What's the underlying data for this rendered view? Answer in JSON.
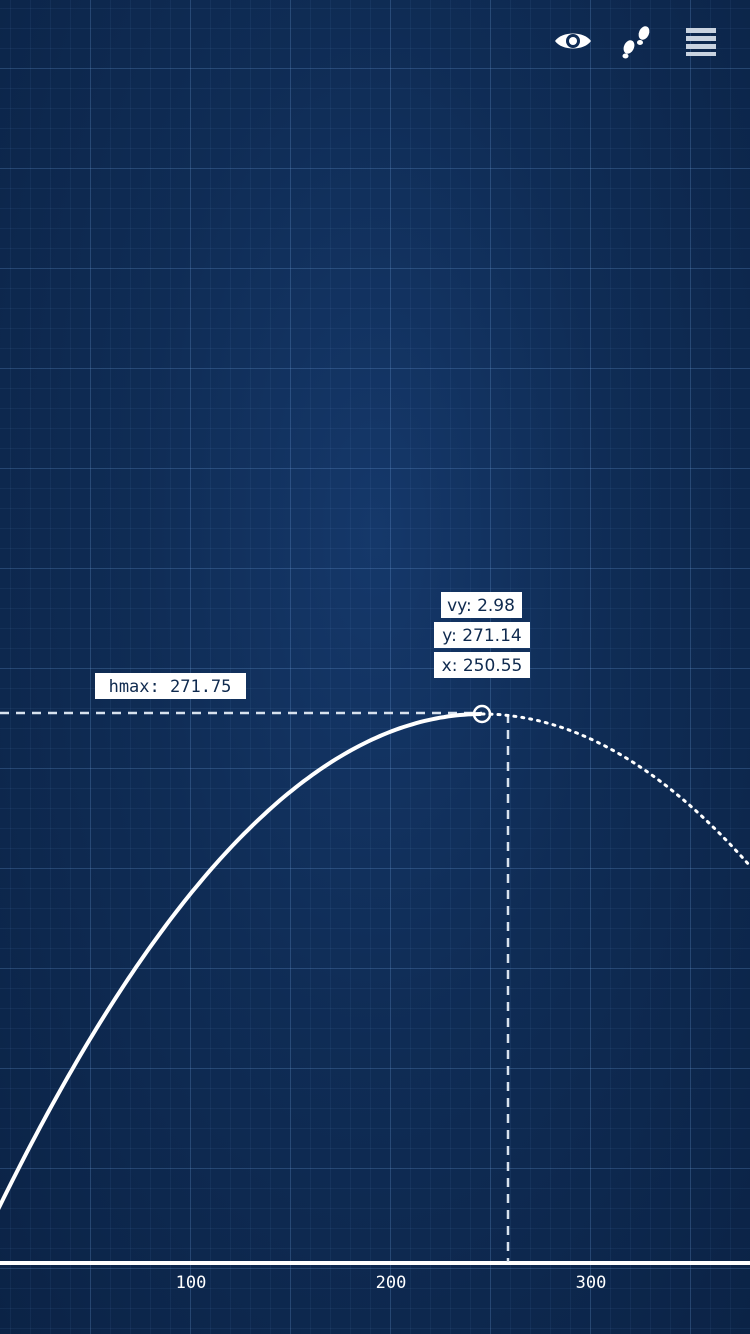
{
  "toolbar": {
    "icons": [
      "eye-icon",
      "footprints-icon",
      "menu-icon"
    ]
  },
  "hmax_label": "hmax: 271.75",
  "readout": {
    "vy": "vy: 2.98",
    "y": "y: 271.14",
    "x": "x: 250.55"
  },
  "chart_data": {
    "type": "line",
    "x_ticks": [
      "100",
      "200",
      "300"
    ],
    "hmax": 271.75,
    "current_point": {
      "x": 250.55,
      "y": 271.14,
      "vy": 2.98
    },
    "colors": {
      "background": "#0f2a4f",
      "curve": "#ffffff",
      "label_bg": "#ffffff",
      "label_text": "#0f2a4f"
    }
  }
}
